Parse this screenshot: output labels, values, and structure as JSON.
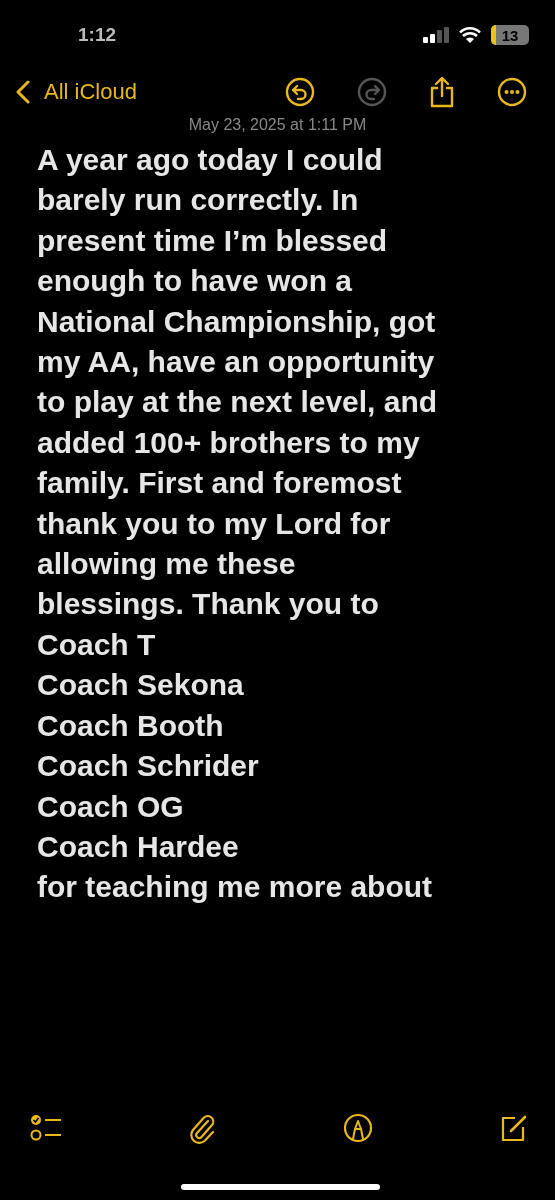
{
  "status_bar": {
    "time": "1:12",
    "battery": "13"
  },
  "nav": {
    "back_label": "All iCloud",
    "undo": {
      "disabled": false
    },
    "redo": {
      "disabled": true
    }
  },
  "note": {
    "timestamp": "May 23, 2025 at 1:11 PM",
    "lines": [
      "A year ago today I could",
      "barely run correctly. In",
      "present time I’m blessed",
      "enough to have won a",
      "National Championship, got",
      "my AA, have an opportunity",
      "to play at the next level, and",
      "added 100+ brothers to my",
      "family. First and foremost",
      "thank you to my Lord for",
      "allowing me these",
      "blessings. Thank you to",
      "Coach T",
      "Coach Sekona",
      "Coach Booth",
      "Coach Schrider",
      "Coach OG",
      "Coach Hardee",
      "for teaching me more about"
    ]
  }
}
